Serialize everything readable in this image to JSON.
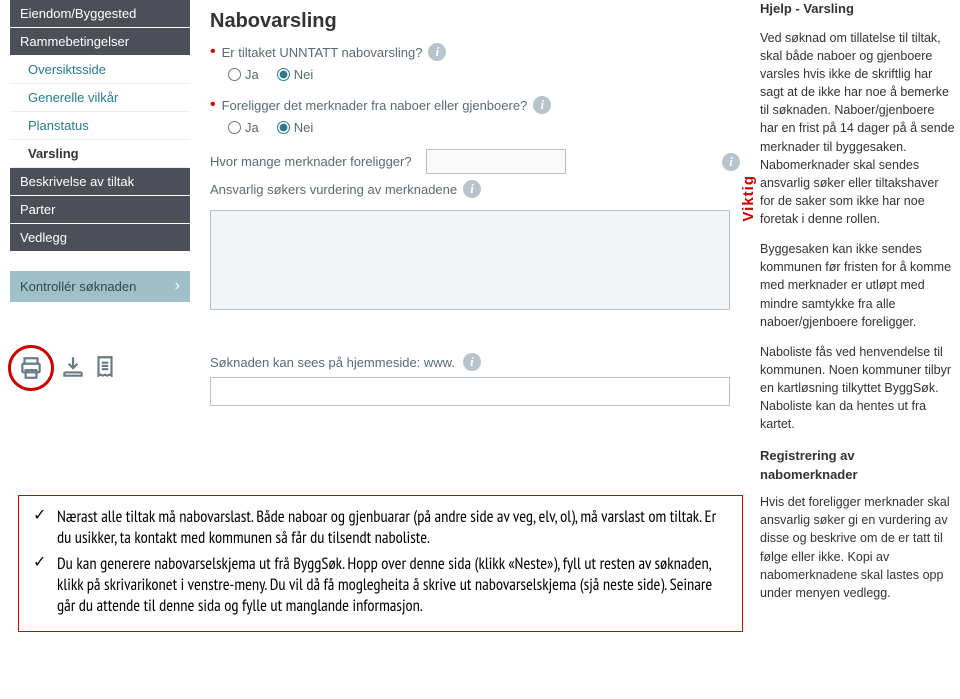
{
  "sidebar": {
    "items": [
      {
        "label": "Eiendom/Byggested",
        "style": "dark"
      },
      {
        "label": "Rammebetingelser",
        "style": "dark"
      },
      {
        "label": "Oversiktsside",
        "style": "light"
      },
      {
        "label": "Generelle vilkår",
        "style": "light"
      },
      {
        "label": "Planstatus",
        "style": "light"
      },
      {
        "label": "Varsling",
        "style": "light-active"
      },
      {
        "label": "Beskrivelse av tiltak",
        "style": "dark"
      },
      {
        "label": "Parter",
        "style": "dark"
      },
      {
        "label": "Vedlegg",
        "style": "dark"
      }
    ],
    "check_label": "Kontrollér søknaden"
  },
  "main": {
    "heading": "Nabovarsling",
    "q1_label": "Er tiltaket UNNTATT nabovarsling?",
    "q2_label": "Foreligger det merknader fra naboer eller gjenboere?",
    "opt_ja": "Ja",
    "opt_nei": "Nei",
    "q3_label": "Hvor mange merknader foreligger?",
    "q4_label": "Ansvarlig søkers vurdering av merknadene",
    "url_label": "Søknaden kan sees på hjemmeside: www."
  },
  "viktig_label": "Viktig",
  "help": {
    "title": "Hjelp - Varsling",
    "p1": "Ved søknad om tillatelse til tiltak, skal både naboer og gjenboere varsles hvis ikke de skriftlig har sagt at de ikke har noe å bemerke til søknaden. Naboer/gjenboere har en frist på 14 dager på å sende merknader til byggesaken. Nabomerknader skal sendes ansvarlig søker eller tiltakshaver for de saker som ikke har noe foretak i denne rollen.",
    "p2": "Byggesaken kan ikke sendes kommunen før fristen for å komme med merknader er utløpt med mindre samtykke fra alle naboer/gjenboere foreligger.",
    "p3": "Naboliste fås ved henvendelse til kommunen. Noen kommuner tilbyr en kartløsning tilkyttet ByggSøk. Naboliste kan da hentes ut fra kartet.",
    "h2": "Registrering av nabomerknader",
    "p4": "Hvis det foreligger merknader skal ansvarlig søker gi en vurdering av disse og beskrive om de er tatt til følge eller ikke. Kopi av nabomerknadene skal lastes opp under menyen vedlegg."
  },
  "notes": {
    "item1": "Nærast alle tiltak må nabovarslast. Både naboar og gjenbuarar (på andre side av veg, elv, ol), må varslast om tiltak. Er du usikker, ta kontakt med kommunen så får du tilsendt naboliste.",
    "item2": "Du kan generere nabovarselskjema ut frå ByggSøk. Hopp over denne sida (klikk «Neste»), fyll ut resten av søknaden, klikk på skrivarikonet i venstre-meny. Du vil då få moglegheita å skrive ut nabovarselskjema (sjå neste side). Seinare går du attende til denne sida og fylle ut manglande informasjon."
  }
}
